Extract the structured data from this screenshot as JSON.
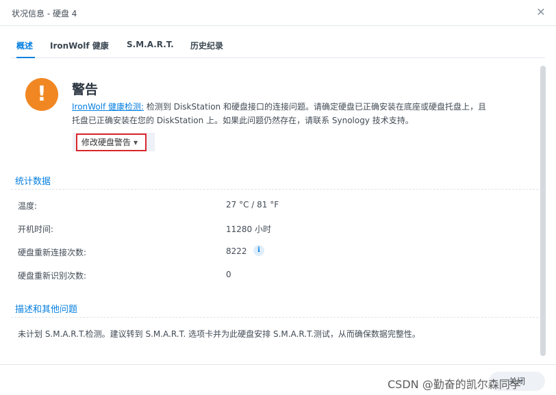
{
  "window": {
    "title": "状况信息 - 硬盘 4"
  },
  "tabs": [
    {
      "label": "概述"
    },
    {
      "label": "IronWolf 健康"
    },
    {
      "label": "S.M.A.R.T."
    },
    {
      "label": "历史纪录"
    }
  ],
  "warning": {
    "icon": "exclamation-icon",
    "icon_color": "#f18723",
    "icon_glyph": "!",
    "title": "警告",
    "link_text": "IronWolf 健康检测:",
    "message_line1": " 检测到 DiskStation 和硬盘接口的连接问题。请确定硬盘已正确安装在底座或硬盘托盘上，且",
    "message_line2": "托盘已正确安装在您的 DiskStation 上。如果此问题仍然存在，请联系 Synology 技术支持。",
    "modify_button": "修改硬盘警告"
  },
  "stats": {
    "title": "统计数据",
    "rows": [
      {
        "label": "温度:",
        "value": "27 °C / 81 °F"
      },
      {
        "label": "开机时间:",
        "value": "11280 小时"
      },
      {
        "label": "硬盘重新连接次数:",
        "value": "8222"
      },
      {
        "label": "硬盘重新识别次数:",
        "value": "0"
      }
    ],
    "info_glyph": "i"
  },
  "description": {
    "title": "描述和其他问题",
    "text": "未计划 S.M.A.R.T.检测。建议转到 S.M.A.R.T. 选项卡并为此硬盘安排 S.M.A.R.T.测试，从而确保数据完整性。"
  },
  "footer": {
    "close_label": "关闭"
  },
  "watermark": "CSDN @勤奋的凯尔森同学",
  "colors": {
    "accent": "#057fe0",
    "highlight": "#d9262c"
  }
}
